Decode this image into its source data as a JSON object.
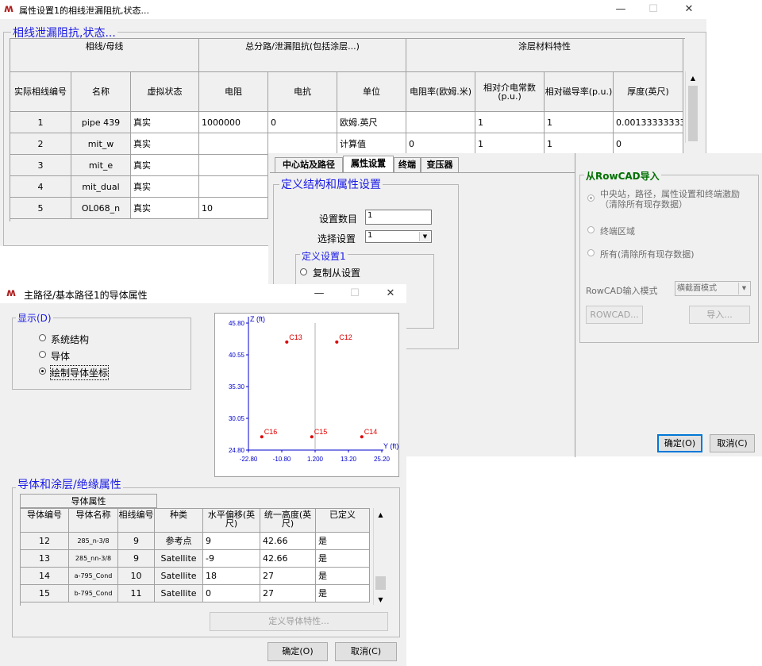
{
  "win_a": {
    "title": "属性设置1的相线泄漏阻抗,状态...",
    "group_label": "相线泄漏阻抗,状态...",
    "top_headers": [
      "相线/母线",
      "总分路/泄漏阻抗(包括涂层...)",
      "涂层材料特性"
    ],
    "col_headers": [
      "实际相线编号",
      "名称",
      "虚拟状态",
      "电阻",
      "电抗",
      "单位",
      "电阻率(欧姆.米)",
      "相对介电常数(p.u.)",
      "相对磁导率(p.u.)",
      "厚度(英尺)"
    ],
    "rows": [
      [
        "1",
        "pipe 439",
        "真实",
        "1000000",
        "0",
        "欧姆.英尺",
        "",
        "1",
        "1",
        "0.001333333333"
      ],
      [
        "2",
        "mit_w",
        "真实",
        "",
        "",
        "计算值",
        "0",
        "1",
        "1",
        "0"
      ],
      [
        "3",
        "mit_e",
        "真实",
        "",
        "",
        "",
        "",
        "",
        "",
        ""
      ],
      [
        "4",
        "mit_dual",
        "真实",
        "",
        "",
        "",
        "",
        "",
        "",
        ""
      ],
      [
        "5",
        "OL068_n",
        "真实",
        "10",
        "",
        "",
        "",
        "",
        "",
        ""
      ]
    ]
  },
  "win_b": {
    "tabs": [
      "中心站及路径",
      "属性设置",
      "终端",
      "变压器"
    ],
    "define_group": "定义结构和属性设置",
    "count_label": "设置数目",
    "count_value": "1",
    "select_label": "选择设置",
    "select_value": "1",
    "define_set_group": "定义设置1",
    "radio_copy": "复制从设置",
    "rowcad_group": "从RowCAD导入",
    "rowcad_options": [
      "中央站，路径，属性设置和终端激励（清除所有现存数据）",
      "终端区域",
      "所有(清除所有现存数据)"
    ],
    "mode_label": "RowCAD输入模式",
    "mode_value": "横截面模式",
    "rowcad_button": "ROWCAD...",
    "import_button": "导入...",
    "ok_button": "确定(O)",
    "cancel_button": "取消(C)"
  },
  "win_c": {
    "title": "主路径/基本路径1的导体属性",
    "display_group": "显示(D)",
    "display_options": [
      "系统结构",
      "导体",
      "绘制导体坐标"
    ],
    "selected_option": 2,
    "conductor_group": "导体和涂层/绝缘属性",
    "conductor_props_header": "导体属性",
    "cond_headers": [
      "导体编号",
      "导体名称",
      "相线编号",
      "种类",
      "水平偏移(英尺)",
      "统一高度(英尺)",
      "已定义"
    ],
    "cond_rows": [
      [
        "12",
        "285_n-3/8",
        "9",
        "参考点",
        "9",
        "42.66",
        "是"
      ],
      [
        "13",
        "285_nn-3/8",
        "9",
        "Satellite",
        "-9",
        "42.66",
        "是"
      ],
      [
        "14",
        "a-795_Cond",
        "10",
        "Satellite",
        "18",
        "27",
        "是"
      ],
      [
        "15",
        "b-795_Cond",
        "11",
        "Satellite",
        "0",
        "27",
        "是"
      ]
    ],
    "define_button": "定义导体特性...",
    "ok_button": "确定(O)",
    "cancel_button": "取消(C)"
  },
  "chart_data": {
    "type": "scatter",
    "title": "",
    "xlabel": "Y (ft)",
    "ylabel": "Z (ft)",
    "xlim": [
      -22.8,
      25.2
    ],
    "ylim": [
      24.8,
      45.8
    ],
    "x_ticks": [
      "-22.80",
      "-10.80",
      "1.200",
      "13.20",
      "25.20"
    ],
    "y_ticks": [
      "45.80",
      "40.55",
      "35.30",
      "30.05",
      "24.80"
    ],
    "points": [
      {
        "label": "C13",
        "x": -9,
        "y": 42.66
      },
      {
        "label": "C12",
        "x": 9,
        "y": 42.66
      },
      {
        "label": "C16",
        "x": -18,
        "y": 27
      },
      {
        "label": "C15",
        "x": 0,
        "y": 27
      },
      {
        "label": "C14",
        "x": 18,
        "y": 27
      }
    ],
    "point_color": "#e00000",
    "axis_color": "#0000cc"
  }
}
